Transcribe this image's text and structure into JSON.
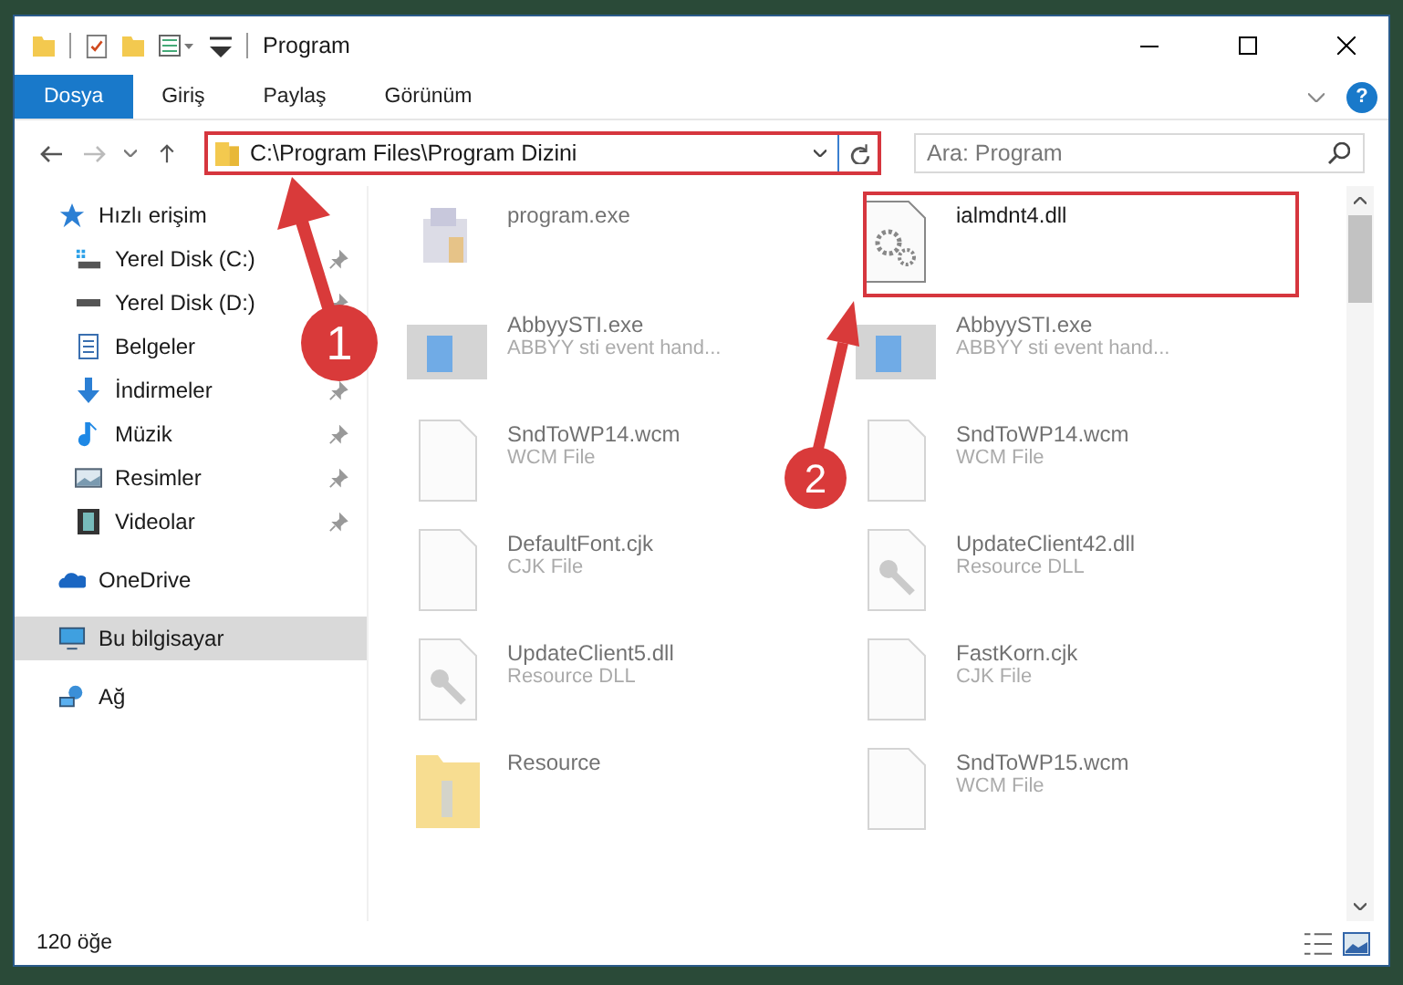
{
  "window": {
    "title": "Program"
  },
  "ribbon": {
    "tabs": [
      {
        "label": "Dosya",
        "selected": true
      },
      {
        "label": "Giriş",
        "selected": false
      },
      {
        "label": "Paylaş",
        "selected": false
      },
      {
        "label": "Görünüm",
        "selected": false
      }
    ],
    "help": "?"
  },
  "navigation": {
    "back_disabled": false,
    "forward_disabled": true
  },
  "address": {
    "path": "C:\\Program Files\\Program Dizini"
  },
  "search": {
    "placeholder": "Ara: Program"
  },
  "sidebar": {
    "items": [
      {
        "label": "Hızlı erişim",
        "kind": "star",
        "selected": false,
        "children": [
          {
            "label": "Yerel Disk (C:)",
            "kind": "drive-c",
            "pinned": true
          },
          {
            "label": "Yerel Disk (D:)",
            "kind": "drive",
            "pinned": true
          },
          {
            "label": "Belgeler",
            "kind": "document"
          },
          {
            "label": "İndirmeler",
            "kind": "download",
            "pinned": true
          },
          {
            "label": "Müzik",
            "kind": "music",
            "pinned": true
          },
          {
            "label": "Resimler",
            "kind": "pictures",
            "pinned": true
          },
          {
            "label": "Videolar",
            "kind": "video",
            "pinned": true
          }
        ]
      },
      {
        "label": "OneDrive",
        "kind": "cloud",
        "selected": false
      },
      {
        "label": "Bu bilgisayar",
        "kind": "computer",
        "selected": true
      },
      {
        "label": "Ağ",
        "kind": "network",
        "selected": false
      }
    ]
  },
  "files": [
    {
      "name": "program.exe",
      "kind": "program",
      "dimmed": true
    },
    {
      "name": "ialmdnt4.dll",
      "kind": "gear",
      "dimmed": false
    },
    {
      "name": "AbbyySTI.exe",
      "description": "ABBYY sti event hand...",
      "kind": "app",
      "dimmed": true
    },
    {
      "name": "AbbyySTI.exe",
      "description": "ABBYY sti event hand...",
      "kind": "app",
      "dimmed": true
    },
    {
      "name": "SndToWP14.wcm",
      "description": "WCM File",
      "kind": "blank",
      "dimmed": true
    },
    {
      "name": "SndToWP14.wcm",
      "description": "WCM File",
      "kind": "blank",
      "dimmed": true
    },
    {
      "name": "DefaultFont.cjk",
      "description": "CJK File",
      "kind": "blank",
      "dimmed": true
    },
    {
      "name": "UpdateClient42.dll",
      "description": "Resource DLL",
      "kind": "dll",
      "dimmed": true
    },
    {
      "name": "UpdateClient5.dll",
      "description": "Resource DLL",
      "kind": "dll",
      "dimmed": true
    },
    {
      "name": "FastKorn.cjk",
      "description": "CJK File",
      "kind": "blank",
      "dimmed": true
    },
    {
      "name": "Resource",
      "kind": "folder",
      "dimmed": true
    },
    {
      "name": "SndToWP15.wcm",
      "description": "WCM File",
      "kind": "blank",
      "dimmed": true
    }
  ],
  "status_bar": {
    "item_count": "120 öğe"
  },
  "callouts": [
    {
      "number": "1"
    },
    {
      "number": "2"
    }
  ]
}
